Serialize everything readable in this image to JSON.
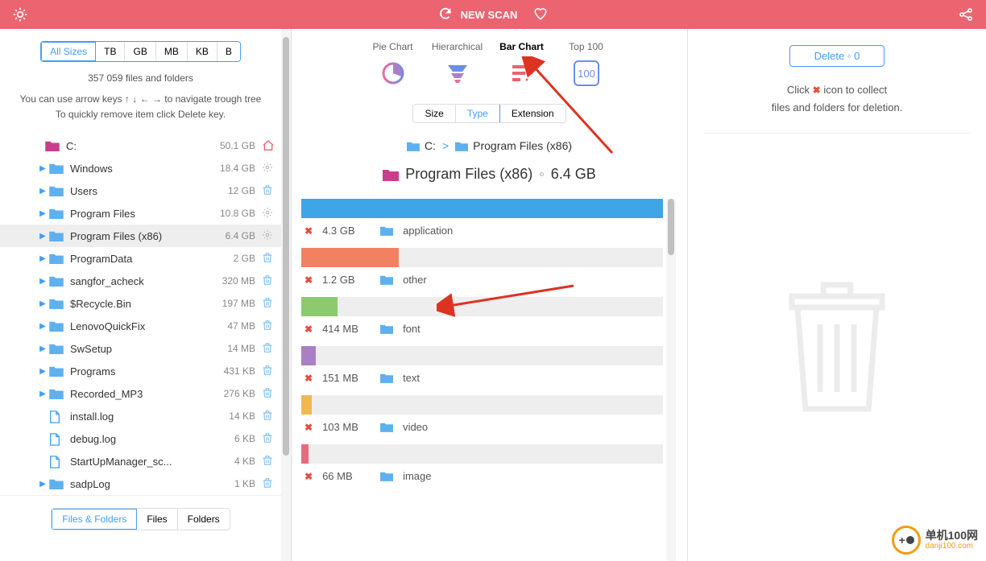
{
  "header": {
    "new_scan": "NEW SCAN"
  },
  "sidebar": {
    "size_filters": [
      "All Sizes",
      "TB",
      "GB",
      "MB",
      "KB",
      "B"
    ],
    "active_size_filter": 0,
    "info": "357 059 files and folders",
    "hint_line1": "You can use arrow keys ↑ ↓ ← → to navigate trough tree",
    "hint_line2": "To quickly remove item click Delete key.",
    "bottom_filters": [
      "Files & Folders",
      "Files",
      "Folders"
    ],
    "active_bottom_filter": 0,
    "tree": [
      {
        "label": "C:",
        "size": "50.1 GB",
        "type": "root",
        "action": "home",
        "indent": 0,
        "expand": false
      },
      {
        "label": "Windows",
        "size": "18.4 GB",
        "type": "folder",
        "action": "gear",
        "indent": 1,
        "expand": true
      },
      {
        "label": "Users",
        "size": "12 GB",
        "type": "folder",
        "action": "trash",
        "indent": 1,
        "expand": true
      },
      {
        "label": "Program Files",
        "size": "10.8 GB",
        "type": "folder",
        "action": "gear",
        "indent": 1,
        "expand": true
      },
      {
        "label": "Program Files (x86)",
        "size": "6.4 GB",
        "type": "folder",
        "action": "gear",
        "indent": 1,
        "expand": true,
        "selected": true
      },
      {
        "label": "ProgramData",
        "size": "2 GB",
        "type": "folder",
        "action": "trash",
        "indent": 1,
        "expand": true
      },
      {
        "label": "sangfor_acheck",
        "size": "320 MB",
        "type": "folder",
        "action": "trash",
        "indent": 1,
        "expand": true
      },
      {
        "label": "$Recycle.Bin",
        "size": "197 MB",
        "type": "folder",
        "action": "trash",
        "indent": 1,
        "expand": true
      },
      {
        "label": "LenovoQuickFix",
        "size": "47 MB",
        "type": "folder",
        "action": "trash",
        "indent": 1,
        "expand": true
      },
      {
        "label": "SwSetup",
        "size": "14 MB",
        "type": "folder",
        "action": "trash",
        "indent": 1,
        "expand": true
      },
      {
        "label": "Programs",
        "size": "431 KB",
        "type": "folder",
        "action": "trash",
        "indent": 1,
        "expand": true
      },
      {
        "label": "Recorded_MP3",
        "size": "276 KB",
        "type": "folder",
        "action": "trash",
        "indent": 1,
        "expand": true
      },
      {
        "label": "install.log",
        "size": "14 KB",
        "type": "file",
        "action": "trash",
        "indent": 1,
        "expand": false
      },
      {
        "label": "debug.log",
        "size": "6 KB",
        "type": "file",
        "action": "trash",
        "indent": 1,
        "expand": false
      },
      {
        "label": "StartUpManager_sc...",
        "size": "4 KB",
        "type": "file",
        "action": "trash",
        "indent": 1,
        "expand": false
      },
      {
        "label": "sadpLog",
        "size": "1 KB",
        "type": "folder",
        "action": "trash",
        "indent": 1,
        "expand": true
      }
    ]
  },
  "center": {
    "view_tabs": [
      "Pie Chart",
      "Hierarchical",
      "Bar Chart",
      "Top 100"
    ],
    "active_view_tab": 2,
    "group_tabs": [
      "Size",
      "Type",
      "Extension"
    ],
    "active_group_tab": 1,
    "breadcrumb": [
      {
        "label": "C:"
      },
      {
        "label": "Program Files (x86)"
      }
    ],
    "current_label": "Program Files (x86)",
    "current_size": "6.4 GB"
  },
  "chart_data": {
    "type": "bar",
    "title": "Program Files (x86) ◦ 6.4 GB",
    "orientation": "horizontal",
    "unit": "bytes",
    "max_pct": 100,
    "series": [
      {
        "name": "application",
        "size_label": "4.3 GB",
        "pct": 100,
        "color": "#3ea6e6"
      },
      {
        "name": "other",
        "size_label": "1.2 GB",
        "pct": 27,
        "color": "#f08262"
      },
      {
        "name": "font",
        "size_label": "414 MB",
        "pct": 10,
        "color": "#8cc96f"
      },
      {
        "name": "text",
        "size_label": "151 MB",
        "pct": 4,
        "color": "#a97fc6"
      },
      {
        "name": "video",
        "size_label": "103 MB",
        "pct": 3,
        "color": "#f0b84e"
      },
      {
        "name": "image",
        "size_label": "66 MB",
        "pct": 2,
        "color": "#e86b7d"
      }
    ]
  },
  "rightpanel": {
    "delete_btn": "Delete ◦ 0",
    "hint_line1_a": "Click ",
    "hint_line1_b": " icon to collect",
    "hint_line2": "files and folders for deletion."
  },
  "watermark": {
    "cn": "单机100网",
    "en": "danji100.com"
  }
}
